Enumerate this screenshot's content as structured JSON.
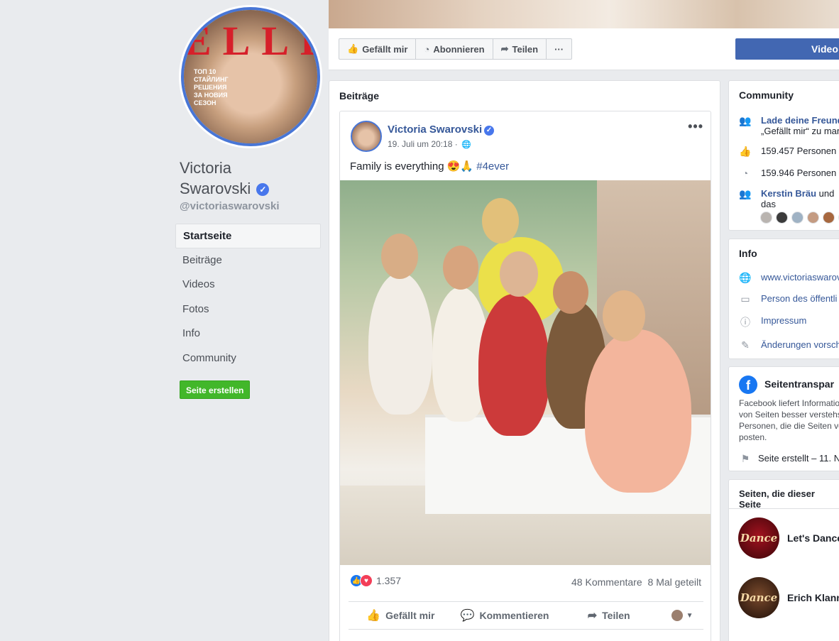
{
  "profile": {
    "name_line1": "Victoria",
    "name_line2": "Swarovski",
    "handle": "@victoriaswarovski",
    "cover_brand": "ELLE",
    "cover_text": [
      "ТОП 10",
      "СТАЙЛИНГ",
      "РЕШЕНИЯ",
      "ЗА НОВИЯ",
      "СЕЗОН"
    ]
  },
  "left_nav": {
    "items": [
      {
        "label": "Startseite",
        "active": true
      },
      {
        "label": "Beiträge"
      },
      {
        "label": "Videos"
      },
      {
        "label": "Fotos"
      },
      {
        "label": "Info"
      },
      {
        "label": "Community"
      }
    ],
    "create_page": "Seite erstellen"
  },
  "header": {
    "buttons": [
      {
        "label": "Gefällt mir",
        "icon": "thumbs-up-icon"
      },
      {
        "label": "Abonnieren",
        "icon": "rss-icon"
      },
      {
        "label": "Teilen",
        "icon": "share-arrow-icon"
      },
      {
        "label": "···",
        "icon": "more-icon"
      }
    ],
    "video_button": "Video"
  },
  "posts": {
    "section_title": "Beiträge",
    "post": {
      "author": "Victoria Swarovski",
      "time": "19. Juli um 20:18 ·",
      "text": "Family is everything 😍🙏",
      "hashtag": "#4ever",
      "reaction_count": "1.357",
      "comments": "48 Kommentare",
      "shares": "8 Mal geteilt",
      "actions": {
        "like": "Gefällt mir",
        "comment": "Kommentieren",
        "share": "Teilen"
      }
    }
  },
  "community": {
    "title": "Community",
    "invite": "Lade deine Freunde",
    "invite_sub": "„Gefällt mir“ zu mar",
    "likes": "159.457 Personen",
    "follows": "159.946 Personen",
    "friend": "Kerstin Bräu",
    "friend_suffix": "und",
    "friend_line2": "das"
  },
  "info": {
    "title": "Info",
    "website": "www.victoriaswarov",
    "category": "Person des öffentli",
    "impressum": "Impressum",
    "suggest": "Änderungen vorsch"
  },
  "transparency": {
    "title": "Seitentranspar",
    "description": "Facebook liefert Informatio von Seiten besser verstehs Personen, die die Seiten ve posten.",
    "created": "Seite erstellt – 11. N"
  },
  "liked_pages": {
    "title": "Seiten, die dieser Seite",
    "items": [
      {
        "name": "Let's Dance",
        "logo": "Dance"
      },
      {
        "name": "Erich Klann",
        "logo": "Dance"
      }
    ]
  },
  "colors": {
    "link": "#365899",
    "brand_blue": "#4267b2",
    "create_green": "#42b72a",
    "verified_badge": "#4877ec"
  }
}
